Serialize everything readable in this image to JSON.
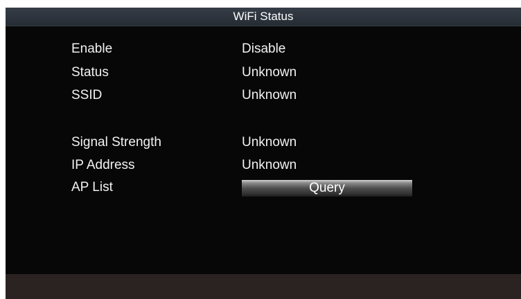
{
  "window": {
    "title": "WiFi Status"
  },
  "fields": {
    "enable": {
      "label": "Enable",
      "value": "Disable"
    },
    "status": {
      "label": "Status",
      "value": "Unknown"
    },
    "ssid": {
      "label": "SSID",
      "value": "Unknown"
    },
    "signal_strength": {
      "label": "Signal Strength",
      "value": "Unknown"
    },
    "ip_address": {
      "label": "IP Address",
      "value": "Unknown"
    },
    "ap_list": {
      "label": "AP List",
      "button_label": "Query"
    }
  },
  "colors": {
    "background": "#070707",
    "title_bar": "#2c323a",
    "bottom_bar": "#2a2322",
    "text": "#f2f2f2"
  }
}
